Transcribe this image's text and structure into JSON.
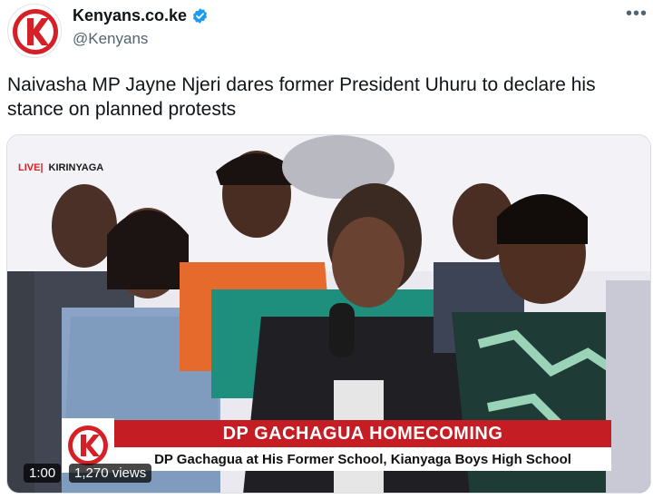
{
  "account": {
    "display_name": "Kenyans.co.ke",
    "handle": "@Kenyans",
    "verified_icon": "verified-badge-icon",
    "avatar_icon": "kenyans-logo-icon"
  },
  "menu": {
    "more_label": "•••"
  },
  "tweet": {
    "text": "Naivasha MP Jayne Njeri dares former President Uhuru to declare his stance on planned protests"
  },
  "video": {
    "live_label": "LIVE|",
    "location": "KIRINYAGA",
    "headline": "DP GACHAGUA HOMECOMING",
    "subheadline": "DP Gachagua at His Former School, Kianyaga Boys High School",
    "duration": "1:00",
    "views": "1,270 views"
  },
  "colors": {
    "brand_red": "#d62028",
    "banner_red": "#c41e24",
    "verified_blue": "#1d9bf0"
  }
}
